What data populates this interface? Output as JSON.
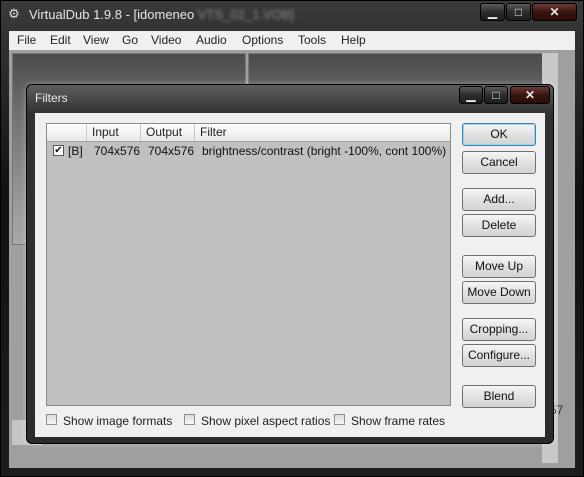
{
  "main_window": {
    "title_visible": "VirtualDub 1.9.8 - [idomeneo",
    "title_blurred": "VTS_02_1.VOB]",
    "buttons": {
      "minimize": "▁",
      "maximize": "□",
      "close": "✕"
    },
    "menu": [
      "File",
      "Edit",
      "View",
      "Go",
      "Video",
      "Audio",
      "Options",
      "Tools",
      "Help"
    ],
    "frame_number_partial": "57"
  },
  "filters_dialog": {
    "title": "Filters",
    "buttons": {
      "minimize": "▁",
      "maximize": "□",
      "close": "✕"
    },
    "columns": [
      "",
      "Input",
      "Output",
      "Filter"
    ],
    "rows": [
      {
        "checked": true,
        "tag": "[B]",
        "input": "704x576",
        "output": "704x576",
        "filter": "brightness/contrast (bright -100%, cont 100%)"
      }
    ],
    "actions": {
      "ok": "OK",
      "cancel": "Cancel",
      "add": "Add...",
      "delete": "Delete",
      "move_up": "Move Up",
      "move_down": "Move Down",
      "cropping": "Cropping...",
      "configure": "Configure...",
      "blend": "Blend"
    },
    "options": [
      {
        "label": "Show image formats",
        "checked": false
      },
      {
        "label": "Show pixel aspect ratios",
        "checked": false
      },
      {
        "label": "Show frame rates",
        "checked": false
      }
    ]
  }
}
